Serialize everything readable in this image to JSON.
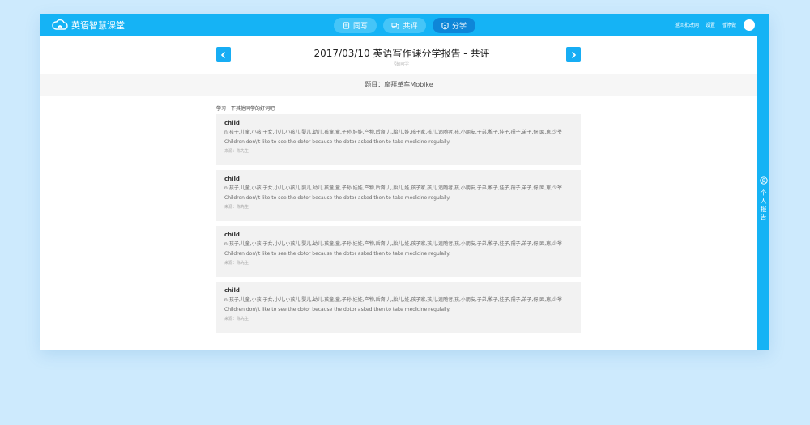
{
  "app": {
    "logo_text": "英语智慧课堂",
    "logo_icon": "cloud-book-icon"
  },
  "nav": {
    "tabs": [
      {
        "label": "同写",
        "icon": "document-icon",
        "active": false
      },
      {
        "label": "共评",
        "icon": "chat-icon",
        "active": false
      },
      {
        "label": "分学",
        "icon": "badge-icon",
        "active": true
      }
    ]
  },
  "top_links": {
    "back": "返回批改网",
    "settings": "设置",
    "homework": "暂停做"
  },
  "report": {
    "title": "2017/03/10 英语写作课分学报告 - 共评",
    "subtitle": "张同学",
    "topic": "题目：摩拜单车Mobike",
    "hint": "学习一下其他同学的好词吧"
  },
  "cards": [
    {
      "word": "child",
      "definition": "n:孩子,儿童,小孩,子女,小儿,小孩儿,婴儿,幼儿,孩童,童,子孙,娃娃,产物,后裔,儿,胎儿,娃,孩子家,孩儿,追随者,孩,小朋友,子弟,稚子,娃子,孺子,弟子,伢,囡,崽,少爷",
      "example": "Children don\\'t like to see the dotor because the dotor asked then to take medicine regulaily.",
      "source": "来源：陈先生"
    },
    {
      "word": "child",
      "definition": "n:孩子,儿童,小孩,子女,小儿,小孩儿,婴儿,幼儿,孩童,童,子孙,娃娃,产物,后裔,儿,胎儿,娃,孩子家,孩儿,追随者,孩,小朋友,子弟,稚子,娃子,孺子,弟子,伢,囡,崽,少爷",
      "example": "Children don\\'t like to see the dotor because the dotor asked then to take medicine regulaily.",
      "source": "来源：陈先生"
    },
    {
      "word": "child",
      "definition": "n:孩子,儿童,小孩,子女,小儿,小孩儿,婴儿,幼儿,孩童,童,子孙,娃娃,产物,后裔,儿,胎儿,娃,孩子家,孩儿,追随者,孩,小朋友,子弟,稚子,娃子,孺子,弟子,伢,囡,崽,少爷",
      "example": "Children don\\'t like to see the dotor because the dotor asked then to take medicine regulaily.",
      "source": "来源：陈先生"
    },
    {
      "word": "child",
      "definition": "n:孩子,儿童,小孩,子女,小儿,小孩儿,婴儿,幼儿,孩童,童,子孙,娃娃,产物,后裔,儿,胎儿,娃,孩子家,孩儿,追随者,孩,小朋友,子弟,稚子,娃子,孺子,弟子,伢,囡,崽,少爷",
      "example": "Children don\\'t like to see the dotor because the dotor asked then to take medicine regulaily.",
      "source": "来源：陈先生"
    }
  ],
  "side_panel": {
    "label": "个人报告",
    "icon": "user-circle-icon"
  },
  "colors": {
    "brand": "#15b3f5",
    "nav_active": "#0e86d8",
    "nav_inactive": "#45c5f8",
    "page_background": "#cdeafd"
  }
}
